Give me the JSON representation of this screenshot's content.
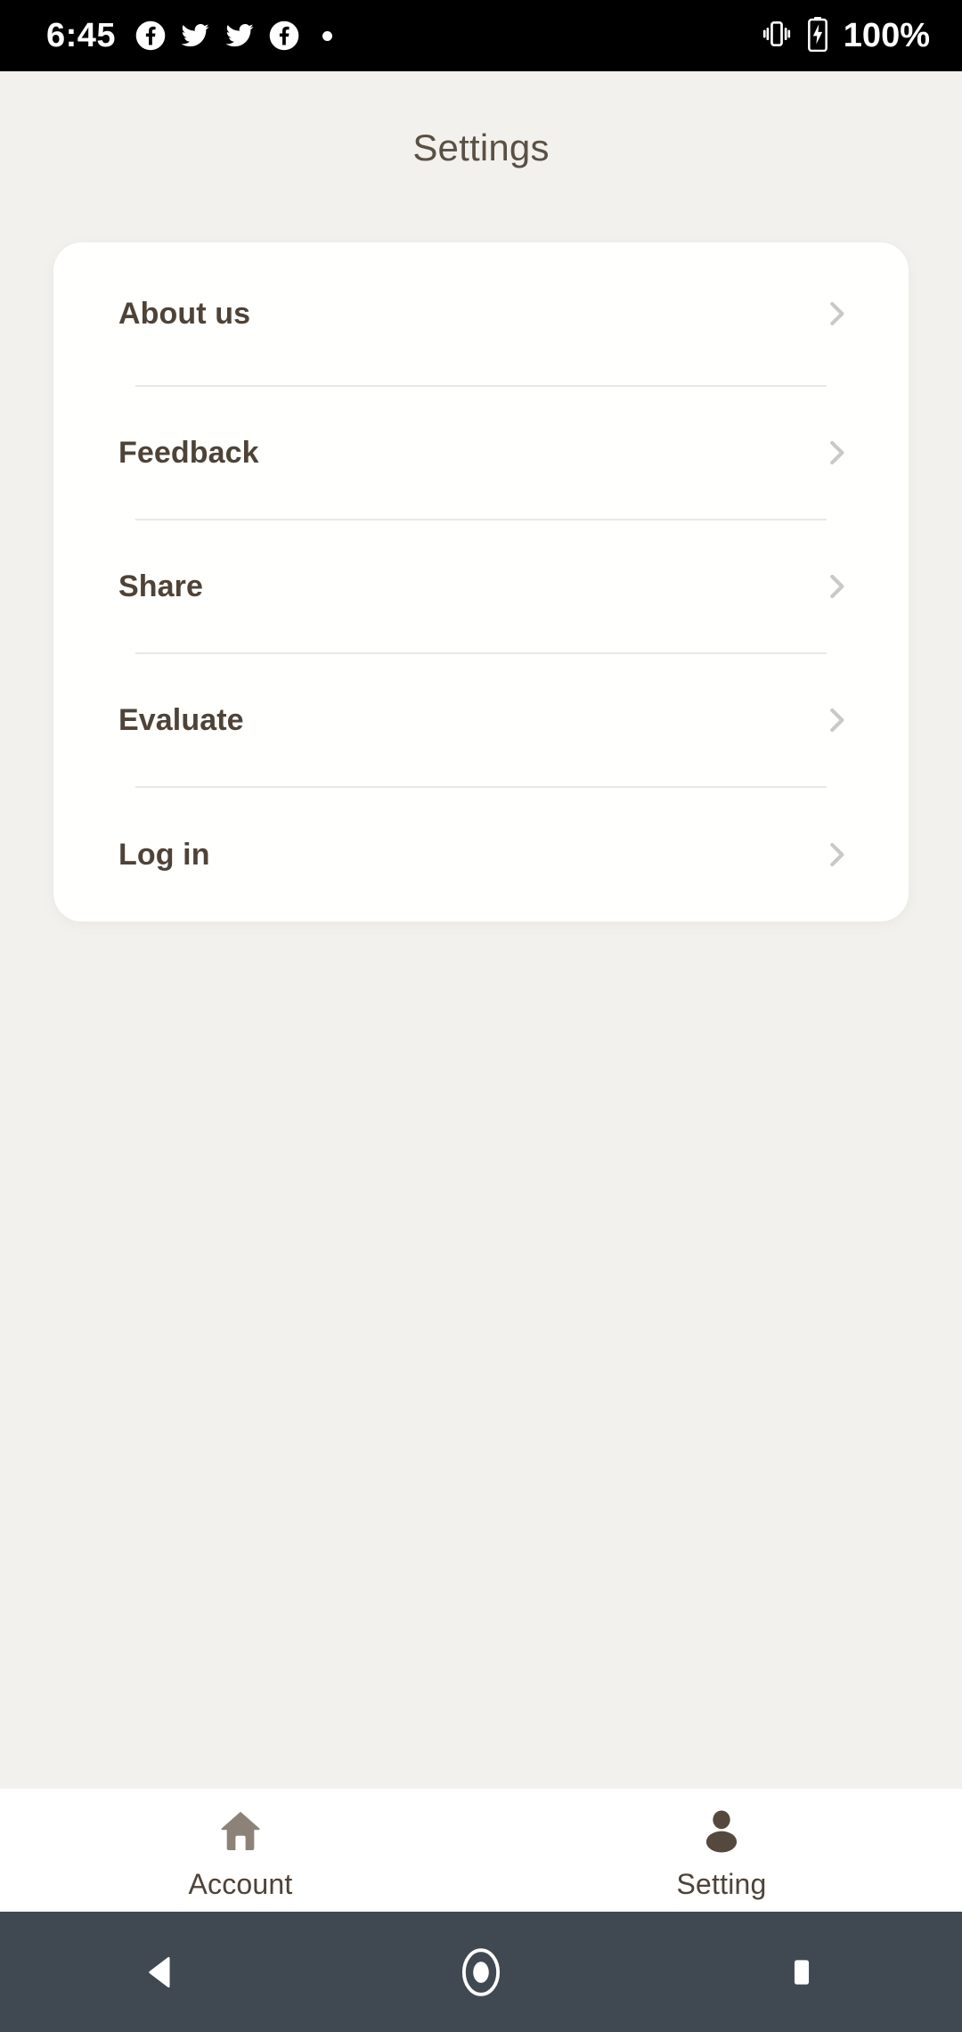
{
  "status_bar": {
    "time": "6:45",
    "battery_percent": "100%",
    "left_icons": [
      "facebook-icon",
      "twitter-icon",
      "twitter-icon",
      "facebook-icon",
      "dot-icon"
    ],
    "right_icons": [
      "vibrate-icon",
      "battery-charging-icon"
    ],
    "background_color": "#000000",
    "foreground_color": "#ffffff"
  },
  "header": {
    "title": "Settings"
  },
  "settings": {
    "rows": [
      {
        "label": "About us",
        "chevron": "chevron-right-icon"
      },
      {
        "label": "Feedback",
        "chevron": "chevron-right-icon"
      },
      {
        "label": "Share",
        "chevron": "chevron-right-icon"
      },
      {
        "label": "Evaluate",
        "chevron": "chevron-right-icon"
      },
      {
        "label": "Log in",
        "chevron": "chevron-right-icon"
      }
    ]
  },
  "bottom_nav": {
    "items": [
      {
        "label": "Account",
        "icon": "home-icon",
        "active": false,
        "color": "#8c8278"
      },
      {
        "label": "Setting",
        "icon": "person-icon",
        "active": true,
        "color": "#55483c"
      }
    ]
  },
  "system_nav": {
    "buttons": [
      "back-icon",
      "home-circle-icon",
      "recents-square-icon"
    ],
    "background_color": "#404952"
  },
  "colors": {
    "page_background": "#f3f1ed",
    "card_background": "#fffffe",
    "text_primary": "#4f4338",
    "title": "#5b5044",
    "divider": "#e8e8e8",
    "chevron": "#c9c9c9"
  }
}
